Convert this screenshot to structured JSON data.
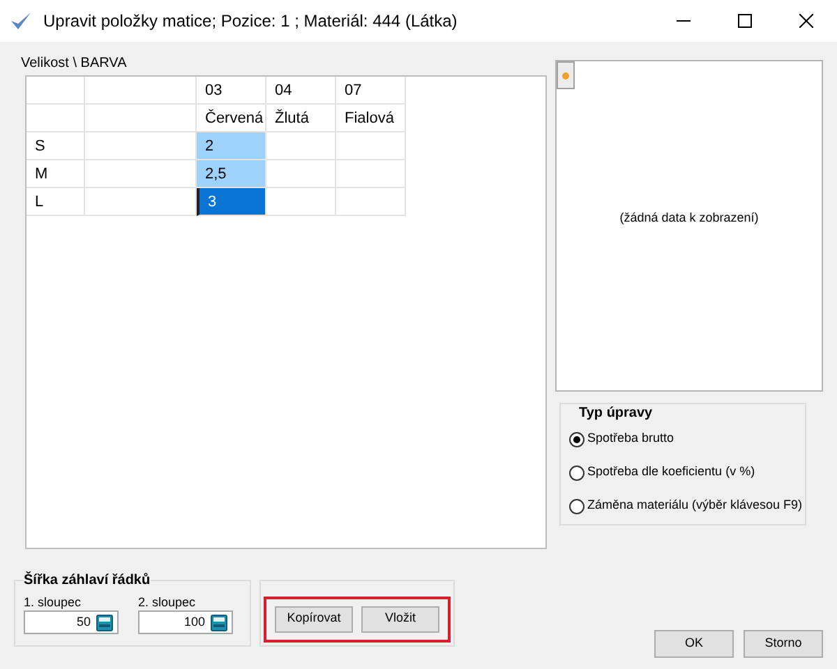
{
  "window": {
    "title": "Upravit položky matice; Pozice: 1 ; Materiál: 444 (Látka)"
  },
  "grid": {
    "label": "Velikost \\ BARVA",
    "columns": [
      {
        "code": "03",
        "name": "Červená"
      },
      {
        "code": "04",
        "name": "Žlutá"
      },
      {
        "code": "07",
        "name": "Fialová"
      }
    ],
    "rows": [
      {
        "label": "S",
        "cells": [
          {
            "value": "2",
            "selected": true,
            "focused": false
          },
          {
            "selected": false,
            "focused": false
          },
          {
            "selected": false,
            "focused": false
          }
        ]
      },
      {
        "label": "M",
        "cells": [
          {
            "value": "2,5",
            "selected": true,
            "focused": false
          },
          {
            "selected": false,
            "focused": false
          },
          {
            "selected": false,
            "focused": false
          }
        ]
      },
      {
        "label": "L",
        "cells": [
          {
            "value": "3",
            "selected": true,
            "focused": true
          },
          {
            "selected": false,
            "focused": false
          },
          {
            "selected": false,
            "focused": false
          }
        ]
      }
    ]
  },
  "preview": {
    "message": "(žádná data k zobrazení)"
  },
  "edit_type": {
    "title": "Typ úpravy",
    "options": [
      {
        "label": "Spotřeba brutto",
        "selected": true
      },
      {
        "label": "Spotřeba dle koeficientu (v %)",
        "selected": false
      },
      {
        "label": "Záměna materiálu (výběr klávesou F9)",
        "selected": false
      }
    ]
  },
  "header_width": {
    "title": "Šířka záhlaví řádků",
    "fields": [
      {
        "label": "1. sloupec",
        "value": "50"
      },
      {
        "label": "2. sloupec",
        "value": "100"
      }
    ]
  },
  "clipboard_buttons": [
    "Kopírovat",
    "Vložit"
  ],
  "dialog_buttons": [
    "OK",
    "Storno"
  ]
}
